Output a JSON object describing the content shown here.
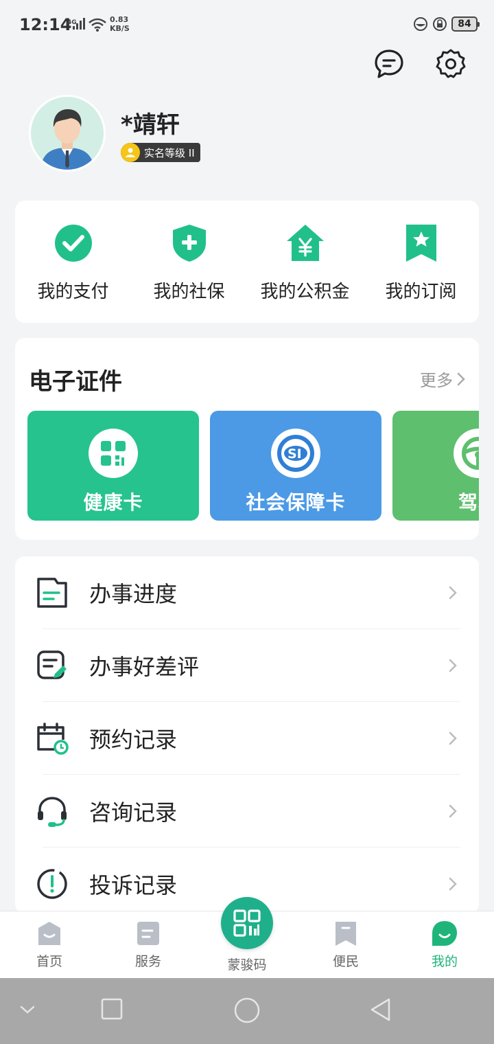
{
  "status_bar": {
    "time": "12:14",
    "network": "4G",
    "speed_value": "0.83",
    "speed_unit": "KB/S",
    "battery": "84"
  },
  "header": {
    "icons": [
      "message-icon",
      "settings-icon"
    ]
  },
  "profile": {
    "username": "*靖轩",
    "badge_text": "实名等级 II"
  },
  "quick_actions": [
    {
      "label": "我的支付",
      "icon": "payment-check-icon"
    },
    {
      "label": "我的社保",
      "icon": "shield-plus-icon"
    },
    {
      "label": "我的公积金",
      "icon": "house-yen-icon"
    },
    {
      "label": "我的订阅",
      "icon": "bookmark-star-icon"
    }
  ],
  "certificates": {
    "title": "电子证件",
    "more": "更多",
    "cards": [
      {
        "label": "健康卡",
        "icon": "qr-code-icon",
        "color": "#26c38e"
      },
      {
        "label": "社会保障卡",
        "icon": "social-security-logo-icon",
        "color": "#4c9ae6"
      },
      {
        "label": "驾驶",
        "icon": "steering-wheel-icon",
        "color": "#5ebf6e"
      }
    ]
  },
  "menu": [
    {
      "label": "办事进度",
      "icon": "document-icon"
    },
    {
      "label": "办事好差评",
      "icon": "review-edit-icon"
    },
    {
      "label": "预约记录",
      "icon": "calendar-clock-icon"
    },
    {
      "label": "咨询记录",
      "icon": "headset-icon"
    },
    {
      "label": "投诉记录",
      "icon": "alert-circle-icon"
    }
  ],
  "tabbar": {
    "items": [
      {
        "label": "首页",
        "icon": "home-icon",
        "active": false
      },
      {
        "label": "服务",
        "icon": "service-icon",
        "active": false
      },
      {
        "label": "蒙骏码",
        "icon": "qr-code-icon",
        "active": false
      },
      {
        "label": "便民",
        "icon": "bookmark-icon",
        "active": false
      },
      {
        "label": "我的",
        "icon": "profile-smile-icon",
        "active": true
      }
    ]
  },
  "colors": {
    "accent": "#1fb57a",
    "health_card": "#26c38e",
    "ss_card": "#4c9ae6",
    "driver_card": "#5ebf6e"
  }
}
